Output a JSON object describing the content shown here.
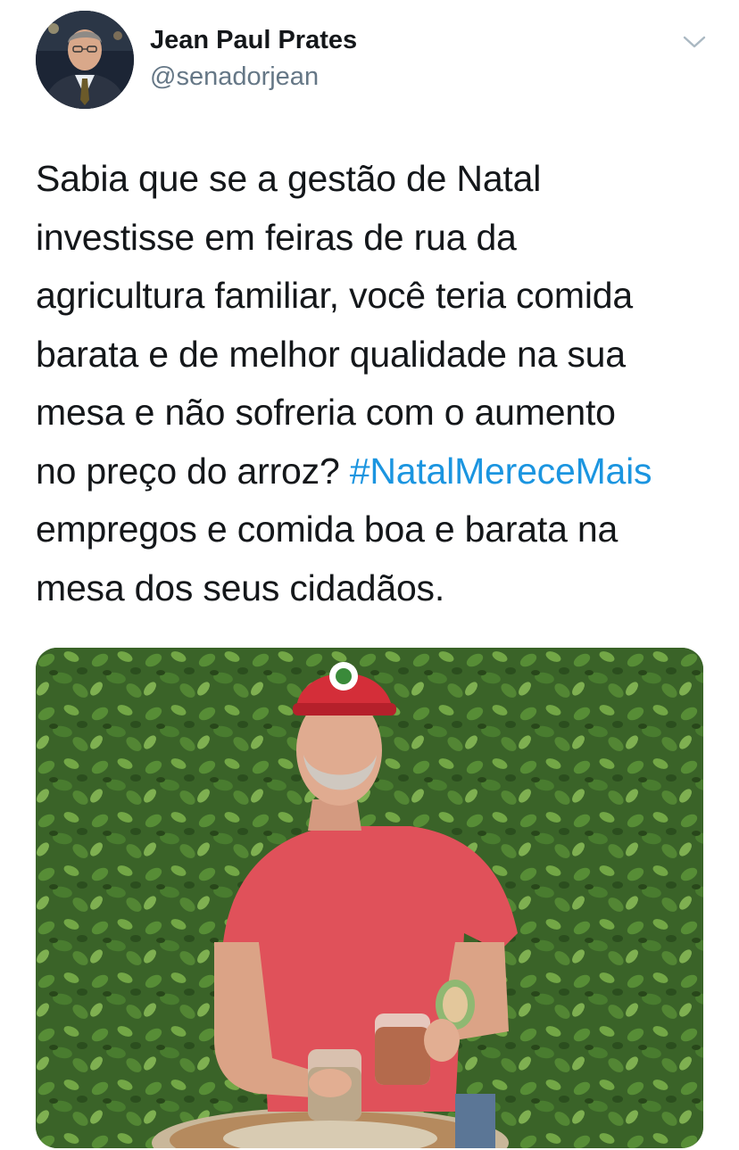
{
  "author": {
    "name": "Jean Paul Prates",
    "handle": "@senadorjean"
  },
  "tweet": {
    "lines": [
      {
        "text": "Sabia que se a gestão de Natal"
      },
      {
        "text": "investisse em feiras de rua da"
      },
      {
        "text": "agricultura familiar, você teria comida"
      },
      {
        "text": "barata e de melhor qualidade na sua"
      },
      {
        "text": "mesa e não sofreria com o aumento"
      },
      {
        "text": "no preço do arroz? ",
        "hashtag": "#NatalMereceMais"
      },
      {
        "text": "empregos e comida boa e barata na"
      },
      {
        "text": "mesa dos seus cidadãos."
      }
    ]
  },
  "icons": {
    "more": "chevron-down-icon"
  },
  "colors": {
    "hashtag": "#1b95e0",
    "handle": "#657786",
    "text": "#14171a"
  }
}
